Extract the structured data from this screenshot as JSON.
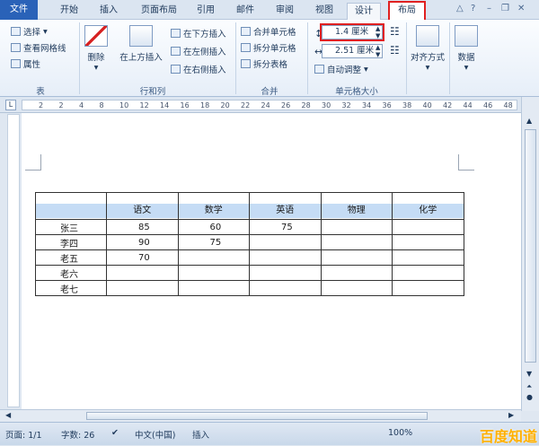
{
  "tabs": {
    "file": "文件",
    "home": "开始",
    "insert": "插入",
    "page_layout": "页面布局",
    "references": "引用",
    "mailings": "邮件",
    "review": "审阅",
    "view": "视图",
    "design": "设计",
    "layout": "布局"
  },
  "ribbon": {
    "table": {
      "select": "选择",
      "gridlines": "查看网格线",
      "properties": "属性",
      "label": "表"
    },
    "rows_cols": {
      "delete": "删除",
      "insert_above": "在上方插入",
      "insert_below": "在下方插入",
      "insert_left": "在左侧插入",
      "insert_right": "在右侧插入",
      "label": "行和列"
    },
    "merge": {
      "merge_cells": "合并单元格",
      "split_cells": "拆分单元格",
      "split_table": "拆分表格",
      "label": "合并"
    },
    "cell_size": {
      "height_value": "1.4 厘米",
      "width_value": "2.51 厘米",
      "autofit": "自动调整",
      "label": "单元格大小"
    },
    "alignment": "对齐方式",
    "data": "数据"
  },
  "ruler": [
    "2",
    "2",
    "4",
    "8",
    "10",
    "12",
    "14",
    "16",
    "18",
    "20",
    "22",
    "24",
    "26",
    "28",
    "30",
    "32",
    "34",
    "36",
    "38",
    "40",
    "42",
    "44",
    "46",
    "48"
  ],
  "table": {
    "headers": [
      "",
      "语文",
      "数学",
      "英语",
      "物理",
      "化学"
    ],
    "rows": [
      [
        "张三",
        "85",
        "60",
        "75",
        "",
        ""
      ],
      [
        "李四",
        "90",
        "75",
        "",
        "",
        ""
      ],
      [
        "老五",
        "70",
        "",
        "",
        "",
        ""
      ],
      [
        "老六",
        "",
        "",
        "",
        "",
        ""
      ],
      [
        "老七",
        "",
        "",
        "",
        "",
        ""
      ]
    ]
  },
  "status": {
    "page": "页面: 1/1",
    "words": "字数: 26",
    "language": "中文(中国)",
    "mode": "插入",
    "zoom": "100%"
  },
  "watermark": "百度知道"
}
